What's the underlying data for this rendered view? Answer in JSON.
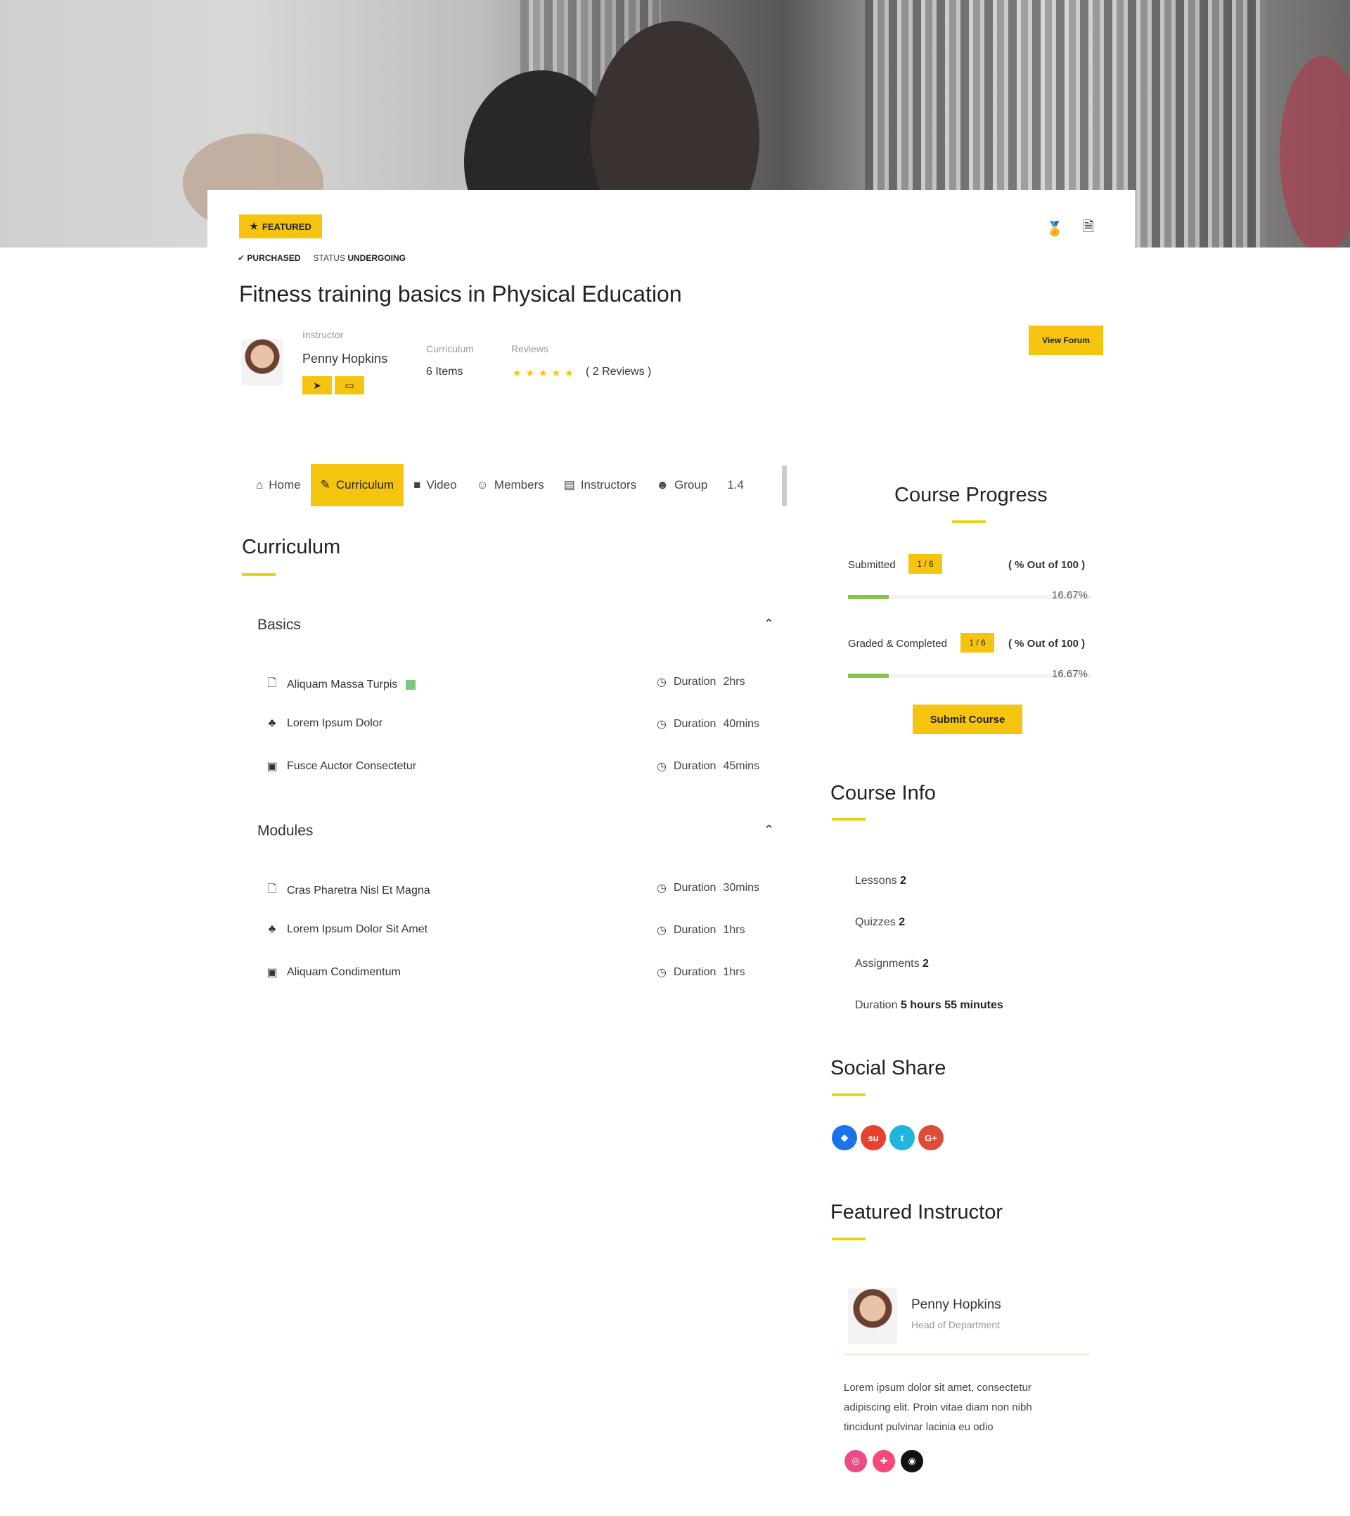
{
  "course": {
    "badge": "FEATURED",
    "purchase_status": "PURCHASED",
    "status_label": "STATUS",
    "status_value": "UNDERGOING",
    "title": "Fitness training basics in Physical Education",
    "instructor_label": "Instructor",
    "instructor_name": "Penny Hopkins",
    "curriculum_label": "Curriculum",
    "curriculum_value": "6 Items",
    "reviews_label": "Reviews",
    "rating": 5,
    "reviews_value": "( 2 Reviews )",
    "view_forum": "View Forum"
  },
  "tabs": [
    {
      "label": "Home",
      "icon": "home-icon"
    },
    {
      "label": "Curriculum",
      "icon": "curriculum-icon",
      "active": true
    },
    {
      "label": "Video",
      "icon": "video-icon"
    },
    {
      "label": "Members",
      "icon": "members-icon"
    },
    {
      "label": "Instructors",
      "icon": "instructors-icon"
    },
    {
      "label": "Group",
      "icon": "group-icon"
    },
    {
      "label": "1.4",
      "icon": ""
    }
  ],
  "curriculum": {
    "heading": "Curriculum",
    "sections": [
      {
        "title": "Basics",
        "units": [
          {
            "title": "Aliquam Massa Turpis",
            "icon": "document-icon",
            "free": true,
            "duration_label": "Duration",
            "duration": "2hrs"
          },
          {
            "title": "Lorem Ipsum Dolor",
            "icon": "puzzle-icon",
            "duration_label": "Duration",
            "duration": "40mins"
          },
          {
            "title": "Fusce Auctor Consectetur",
            "icon": "assignment-icon",
            "duration_label": "Duration",
            "duration": "45mins"
          }
        ]
      },
      {
        "title": "Modules",
        "units": [
          {
            "title": "Cras Pharetra Nisl Et Magna",
            "icon": "document-icon",
            "duration_label": "Duration",
            "duration": "30mins"
          },
          {
            "title": "Lorem Ipsum Dolor Sit Amet",
            "icon": "puzzle-icon",
            "duration_label": "Duration",
            "duration": "1hrs"
          },
          {
            "title": "Aliquam Condimentum",
            "icon": "assignment-icon",
            "duration_label": "Duration",
            "duration": "1hrs"
          }
        ]
      }
    ]
  },
  "progress": {
    "heading": "Course Progress",
    "rows": [
      {
        "label": "Submitted",
        "chip": "1 / 6",
        "out_of": "( % Out of 100 )",
        "percent": "16.67%",
        "fill": 0.1667
      },
      {
        "label": "Graded & Completed",
        "chip": "1 / 6",
        "out_of": "( % Out of 100 )",
        "percent": "16.67%",
        "fill": 0.1667
      }
    ],
    "submit": "Submit Course"
  },
  "course_info": {
    "heading": "Course Info",
    "rows": [
      {
        "label": "Lessons",
        "value": "2"
      },
      {
        "label": "Quizzes",
        "value": "2"
      },
      {
        "label": "Assignments",
        "value": "2"
      },
      {
        "label": "Duration",
        "value": "5 hours 55 minutes"
      }
    ]
  },
  "social_share": {
    "heading": "Social Share",
    "items": [
      {
        "name": "delicious",
        "color": "#1a73e8"
      },
      {
        "name": "stumbleupon",
        "color": "#e9412d"
      },
      {
        "name": "tumblr",
        "color": "#1fb5dd"
      },
      {
        "name": "google-plus",
        "color": "#dd4b39"
      }
    ]
  },
  "featured_instructor": {
    "heading": "Featured Instructor",
    "name": "Penny Hopkins",
    "role": "Head of Department",
    "bio": "Lorem ipsum dolor sit amet, consectetur adipiscing elit. Proin vitae diam non nibh tincidunt pulvinar lacinia eu odio",
    "social": [
      {
        "name": "dribbble",
        "color": "#ea4c89"
      },
      {
        "name": "foursquare",
        "color": "#f94877"
      },
      {
        "name": "github",
        "color": "#111111"
      }
    ]
  },
  "colors": {
    "accent": "#f4c40f",
    "underline": "#e8d21a",
    "progress": "#8bc34a"
  }
}
